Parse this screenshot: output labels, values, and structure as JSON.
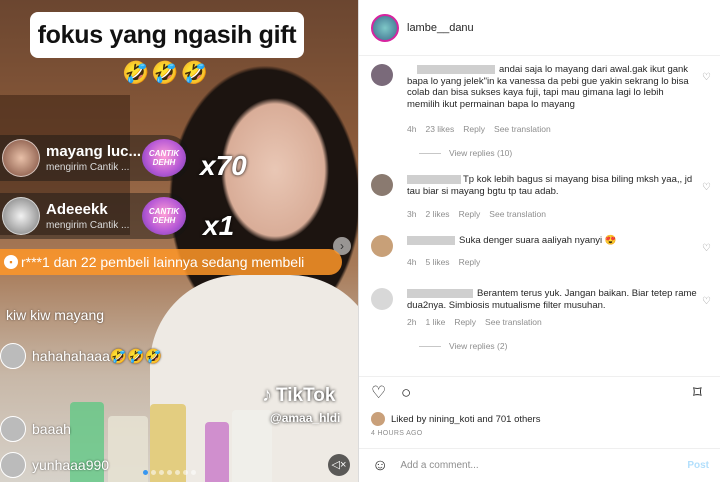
{
  "video": {
    "caption": "fokus yang ngasih gift",
    "caption_emoji": "🤣🤣🤣",
    "gifts": [
      {
        "name": "mayang luc...",
        "sub": "mengirim Cantik ...",
        "badge": "CANTIK DEHH",
        "count": "x70"
      },
      {
        "name": "Adeeekk",
        "sub": "mengirim Cantik ...",
        "badge": "CANTIK DEHH",
        "count": "x1"
      }
    ],
    "buy_banner": "r***1 dan 22 pembeli lainnya sedang membeli",
    "chat": [
      {
        "text": "kiw kiw mayang"
      },
      {
        "text": "hahahahaaa🤣🤣🤣"
      },
      {
        "text": "baaah"
      },
      {
        "text": "yunhaaa990"
      }
    ],
    "watermark_brand": "TikTok",
    "watermark_handle": "@amaa_hldi"
  },
  "post": {
    "username": "lambe__danu",
    "comments": [
      {
        "text": "andai saja lo mayang dari awal.gak ikut gank bapa lo yang jelek\"in ka vanessa da pebi gue yakin sekrang lo bisa colab dan bisa sukses kaya fuji, tapi mau gimana lagi lo lebih memilih ikut permainan bapa lo mayang",
        "time": "4h",
        "likes": "23 likes",
        "reply": "Reply",
        "translate": "See translation",
        "view_replies": "View replies (10)"
      },
      {
        "text": "Tp kok lebih bagus si mayang bisa biling mksh yaa,, jd tau biar si mayang bgtu tp tau adab.",
        "time": "3h",
        "likes": "2 likes",
        "reply": "Reply",
        "translate": "See translation"
      },
      {
        "text": "Suka denger suara aaliyah nyanyi 😍",
        "time": "4h",
        "likes": "5 likes",
        "reply": "Reply"
      },
      {
        "text": "Berantem terus yuk. Jangan baikan. Biar tetep rame dua2nya. Simbiosis mutualisme filter musuhan.",
        "time": "2h",
        "likes": "1 like",
        "reply": "Reply",
        "translate": "See translation",
        "view_replies": "View replies (2)"
      }
    ],
    "liked_by": "Liked by nining_koti and 701 others",
    "time_ago": "4 HOURS AGO",
    "add_comment_placeholder": "Add a comment...",
    "post_button": "Post"
  }
}
